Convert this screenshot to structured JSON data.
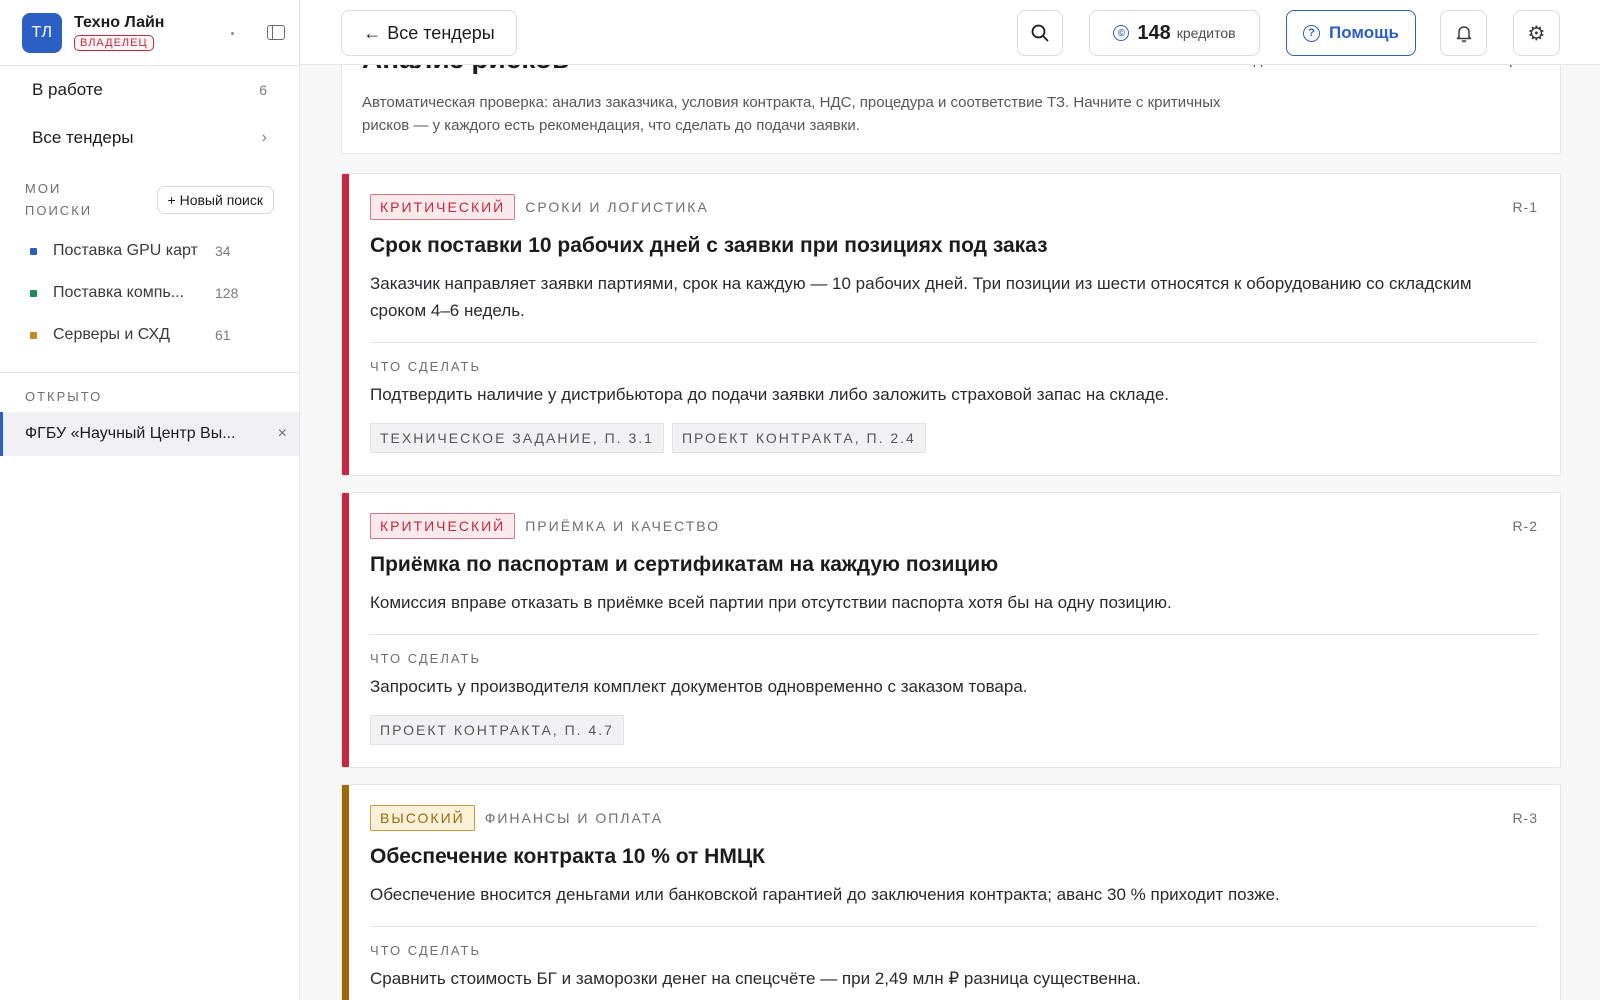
{
  "sidebar": {
    "org": {
      "initials": "ТЛ",
      "name": "Техно Лайн",
      "role": "ВЛАДЕЛЕЦ"
    },
    "nav": [
      {
        "label": "В работе",
        "count": "6"
      },
      {
        "label": "Все тендеры",
        "chevron": "›"
      }
    ],
    "searches_label": "МОИ ПОИСКИ",
    "new_search_label": "+ Новый поиск",
    "searches": [
      {
        "name": "Поставка GPU карт",
        "count": "34",
        "color": "#2b5fc4"
      },
      {
        "name": "Поставка компь...",
        "count": "128",
        "color": "#1f8a5b"
      },
      {
        "name": "Серверы и СХД",
        "count": "61",
        "color": "#c58a24"
      }
    ],
    "open_label": "ОТКРЫТО",
    "open_item": {
      "name": "ФГБУ «Научный Центр Вы...",
      "close": "×"
    }
  },
  "topbar": {
    "back_label": "Все тендеры",
    "back_arrow": "←",
    "credits_icon": "©",
    "credits_value": "148",
    "credits_unit": "кредитов",
    "help_icon": "?",
    "help_label": "Помощь",
    "gear_glyph": "⚙"
  },
  "header": {
    "title": "Анализ рисков",
    "description": "Автоматическая проверка: анализ заказчика, условия контракта, НДС, процедура и соответствие ТЗ. Начните с критичных рисков — у каждого есть рекомендация, что сделать до подачи заявки.",
    "actions": [
      "Поделиться",
      "PDF",
      "Экспорт"
    ]
  },
  "todo_label": "ЧТО СДЕЛАТЬ",
  "colors": {
    "critical": "#c8283f",
    "high": "#9e6a05",
    "brand": "#2b5fc4"
  },
  "risks": [
    {
      "severity": "КРИТИЧЕСКИЙ",
      "category": "СРОКИ И ЛОГИСТИКА",
      "id": "R-1",
      "title": "Срок поставки 10 рабочих дней с заявки при позициях под заказ",
      "text": "Заказчик направляет заявки партиями, срок на каждую — 10 рабочих дней. Три позиции из шести относятся к оборудованию со складским сроком 4–6 недель.",
      "todo": "Подтвердить наличие у дистрибьютора до подачи заявки либо заложить страховой запас на складе.",
      "refs": [
        "ТЕХНИЧЕСКОЕ ЗАДАНИЕ, П. 3.1",
        "ПРОЕКТ КОНТРАКТА, П. 2.4"
      ]
    },
    {
      "severity": "КРИТИЧЕСКИЙ",
      "category": "ПРИЁМКА И КАЧЕСТВО",
      "id": "R-2",
      "title": "Приёмка по паспортам и сертификатам на каждую позицию",
      "text": "Комиссия вправе отказать в приёмке всей партии при отсутствии паспорта хотя бы на одну позицию.",
      "todo": "Запросить у производителя комплект документов одновременно с заказом товара.",
      "refs": [
        "ПРОЕКТ КОНТРАКТА, П. 4.7"
      ]
    },
    {
      "severity": "ВЫСОКИЙ",
      "category": "ФИНАНСЫ И ОПЛАТА",
      "id": "R-3",
      "title": "Обеспечение контракта 10 % от НМЦК",
      "text": "Обеспечение вносится деньгами или банковской гарантией до заключения контракта; аванс 30 % приходит позже.",
      "todo": "Сравнить стоимость БГ и заморозки денег на спецсчёте — при 2,49 млн ₽ разница существенна.",
      "refs": []
    }
  ]
}
